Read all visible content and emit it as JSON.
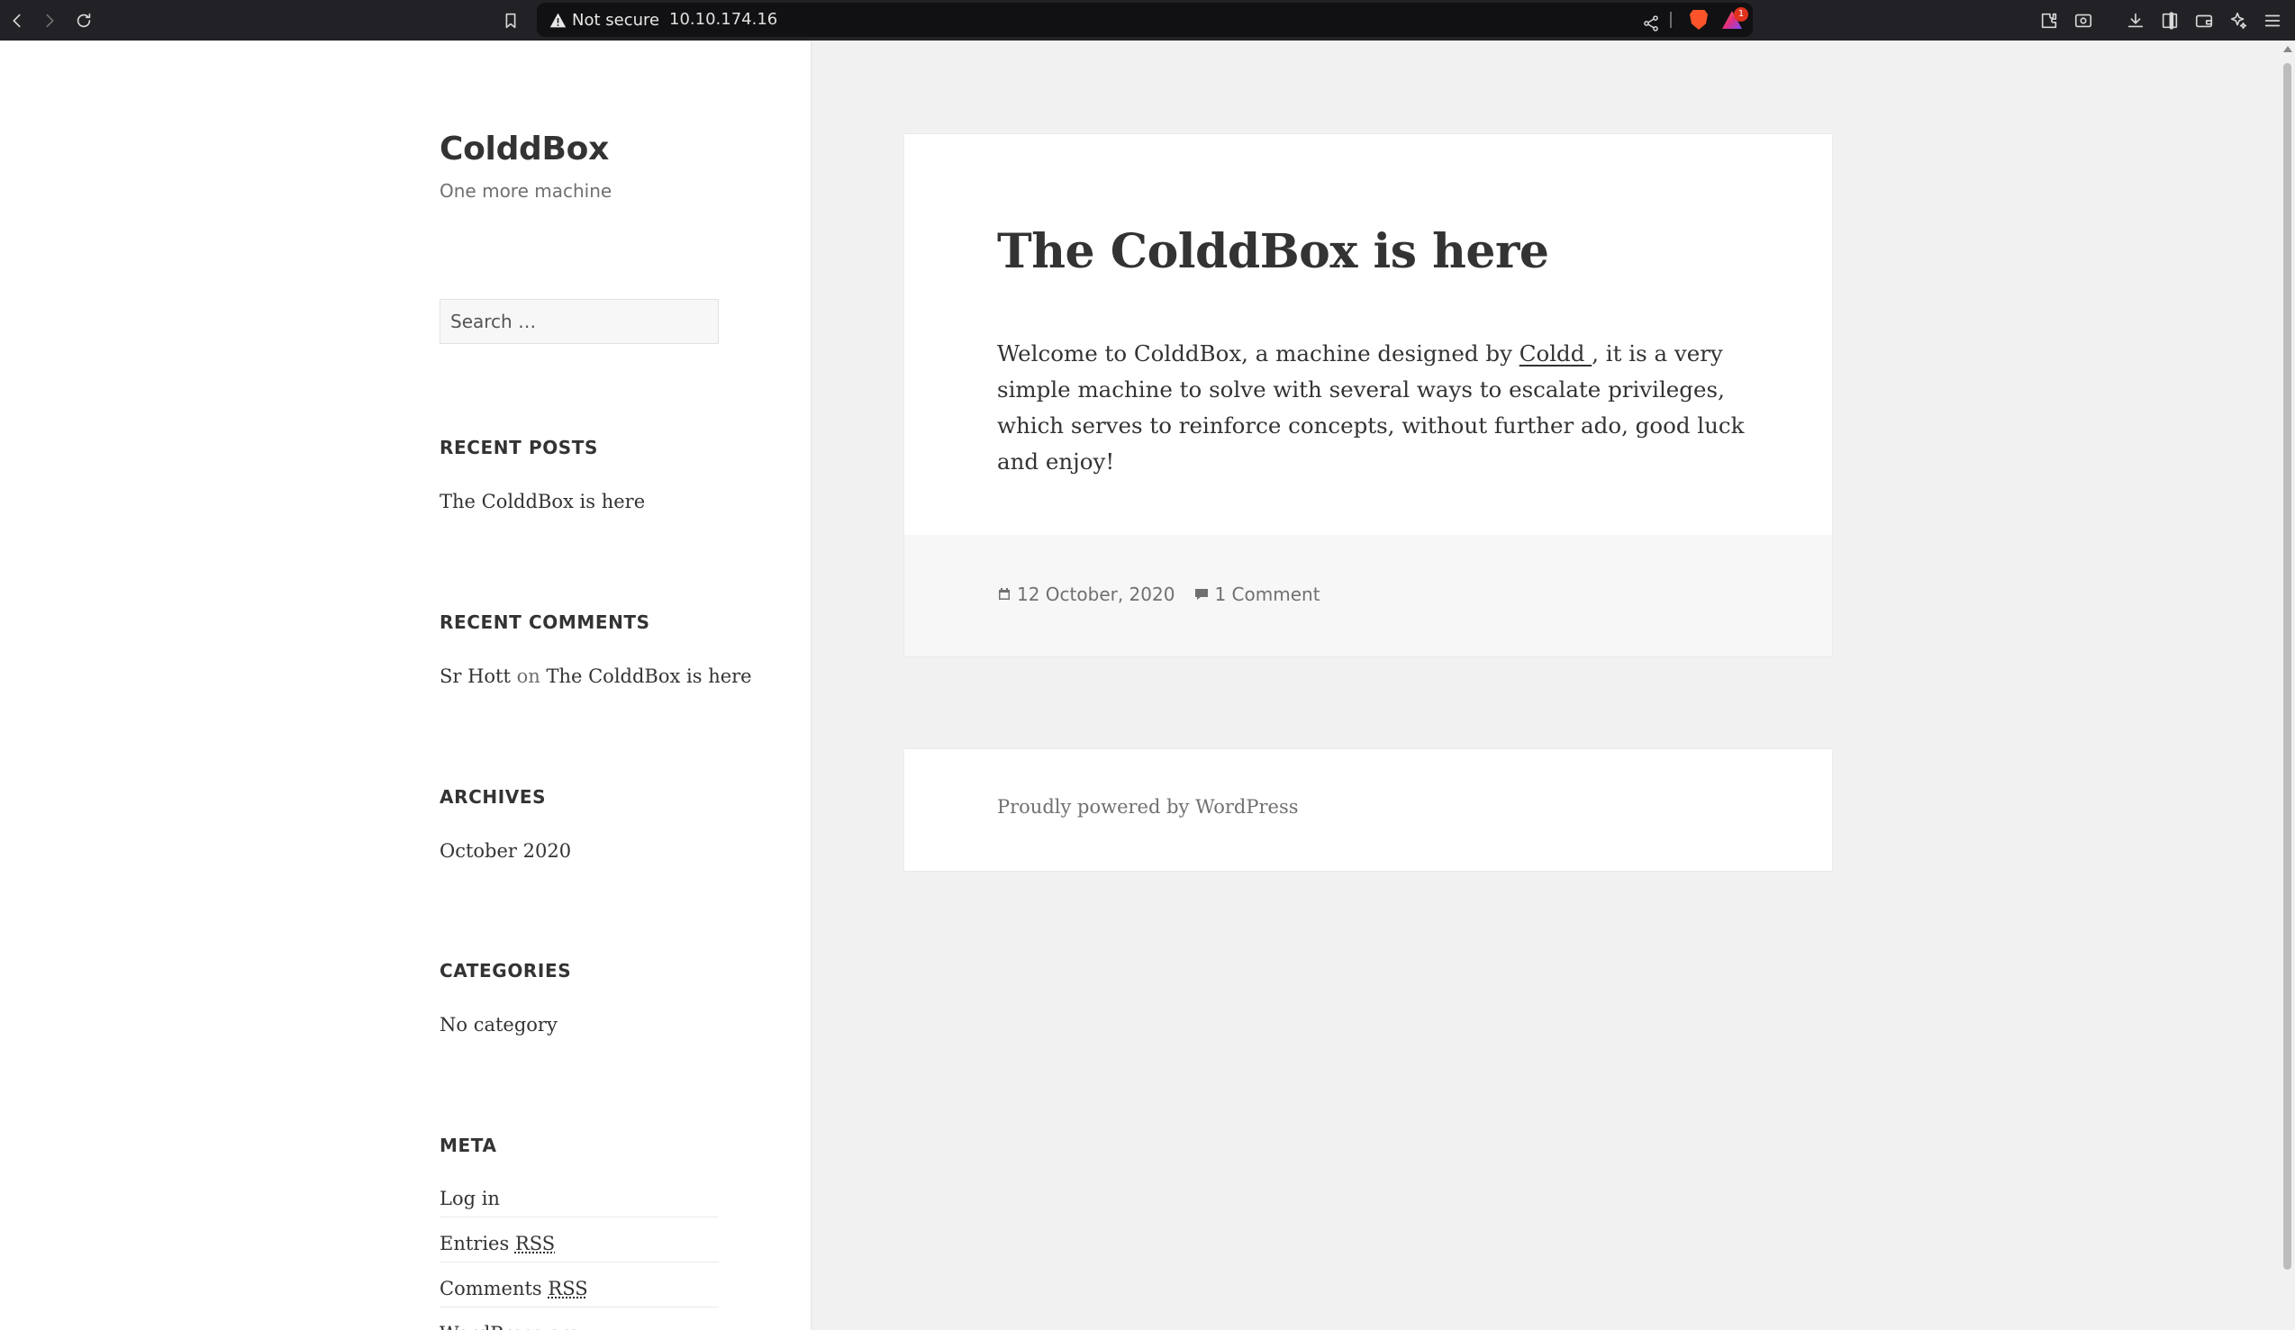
{
  "browser": {
    "security_label": "Not secure",
    "url": "10.10.174.16",
    "rewards_badge": "1",
    "icons": [
      "back-icon",
      "forward-icon",
      "reload-icon",
      "bookmark-icon",
      "warning-icon",
      "share-icon",
      "brave-shields-icon",
      "brave-rewards-icon",
      "extensions-icon",
      "screenshot-icon",
      "download-icon",
      "sidebar-icon",
      "wallet-icon",
      "leo-icon",
      "menu-icon"
    ]
  },
  "site": {
    "title": "ColddBox",
    "description": "One more machine"
  },
  "search": {
    "placeholder": "Search …"
  },
  "widgets": {
    "recent_posts": {
      "title": "RECENT POSTS",
      "items": [
        "The ColddBox is here"
      ]
    },
    "recent_comments": {
      "title": "RECENT COMMENTS",
      "author": "Sr Hott",
      "on": "on",
      "post": "The ColddBox is here"
    },
    "archives": {
      "title": "ARCHIVES",
      "items": [
        "October 2020"
      ]
    },
    "categories": {
      "title": "CATEGORIES",
      "items": [
        "No category"
      ]
    },
    "meta": {
      "title": "META",
      "login": "Log in",
      "entries_prefix": "Entries",
      "comments_prefix": "Comments",
      "rss": "RSS",
      "partial": "WordPress.org"
    }
  },
  "post": {
    "title": "The ColddBox is here",
    "body_before": "Welcome to ColddBox, a machine designed by ",
    "author_link": "Coldd ",
    "body_after": ", it is a very simple machine to solve with several ways to escalate privileges, which serves to reinforce concepts, without further ado, good luck and enjoy!",
    "date": "12 October, 2020",
    "comments": "1 Comment"
  },
  "footer": {
    "powered": "Proudly powered by WordPress"
  },
  "colors": {
    "chrome_bg": "#222226",
    "urlbar_bg": "#111113",
    "page_bg": "#f1f1f1",
    "text": "#333333",
    "muted": "#707070",
    "brave_orange": "#fb542b"
  }
}
